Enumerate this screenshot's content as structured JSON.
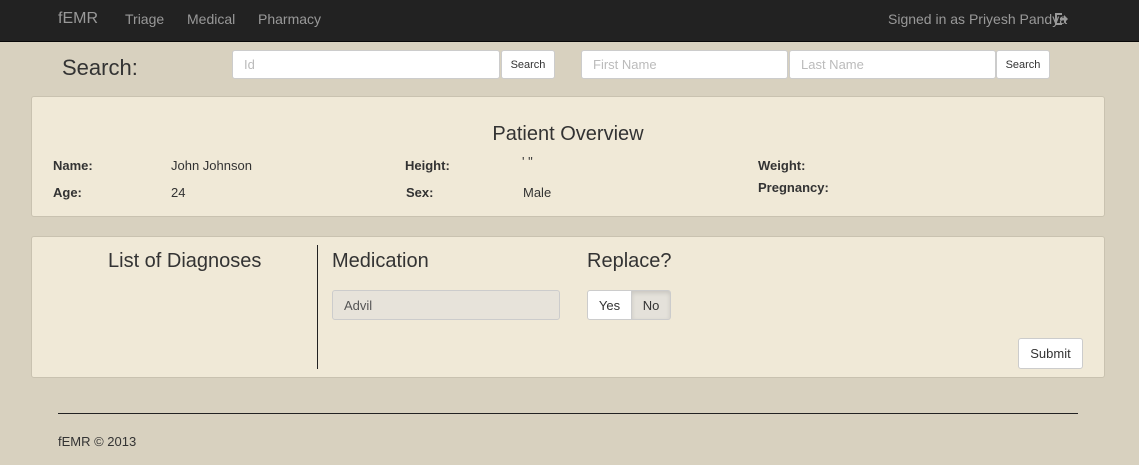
{
  "navbar": {
    "brand": "fEMR",
    "links": [
      "Triage",
      "Medical",
      "Pharmacy"
    ],
    "signed_in": "Signed in as Priyesh Pandya",
    "logout_icon": "sign-out-icon"
  },
  "search": {
    "title": "Search:",
    "id_placeholder": "Id",
    "id_button": "Search",
    "first_name_placeholder": "First Name",
    "last_name_placeholder": "Last Name",
    "name_button": "Search"
  },
  "overview": {
    "title": "Patient Overview",
    "name_label": "Name:",
    "name_value": "John Johnson",
    "age_label": "Age:",
    "age_value": "24",
    "height_label": "Height:",
    "height_value": "' \"",
    "sex_label": "Sex:",
    "sex_value": "Male",
    "weight_label": "Weight:",
    "pregnancy_label": "Pregnancy:"
  },
  "prescriptions": {
    "diagnoses_title": "List of Diagnoses",
    "medication_title": "Medication",
    "medication_value": "Advil",
    "replace_title": "Replace?",
    "yes_label": "Yes",
    "no_label": "No",
    "selected": "No",
    "submit_label": "Submit"
  },
  "footer": {
    "text": "fEMR © 2013"
  },
  "colors": {
    "navbar_bg": "#222222",
    "page_bg": "#d8d1bf",
    "panel_bg": "#f0e9d7"
  }
}
